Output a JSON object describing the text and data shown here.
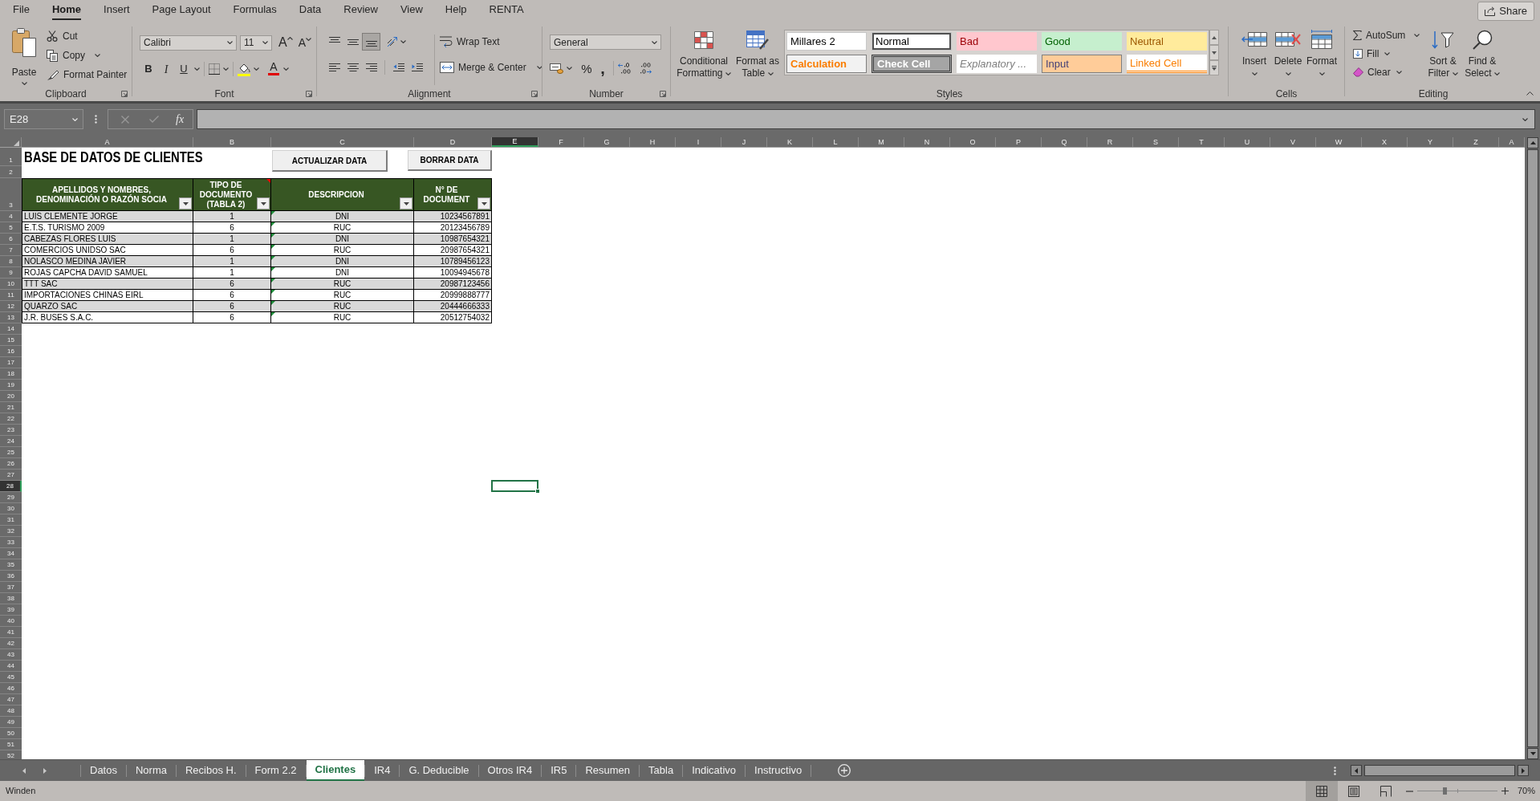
{
  "ribbon_tabs": [
    {
      "label": "File",
      "selected": false
    },
    {
      "label": "Home",
      "selected": true
    },
    {
      "label": "Insert",
      "selected": false
    },
    {
      "label": "Page Layout",
      "selected": false
    },
    {
      "label": "Formulas",
      "selected": false
    },
    {
      "label": "Data",
      "selected": false
    },
    {
      "label": "Review",
      "selected": false
    },
    {
      "label": "View",
      "selected": false
    },
    {
      "label": "Help",
      "selected": false
    },
    {
      "label": "RENTA",
      "selected": false
    }
  ],
  "share_button": {
    "label": "Share"
  },
  "ribbon": {
    "clipboard": {
      "paste": "Paste",
      "cut": "Cut",
      "copy": "Copy",
      "format_painter": "Format Painter",
      "label": "Clipboard"
    },
    "font": {
      "font_name": "Calibri",
      "font_size": "11",
      "grow_font": "A",
      "shrink_font": "A",
      "bold": "B",
      "italic": "I",
      "underline": "U",
      "font_color": "A",
      "label": "Font"
    },
    "alignment": {
      "vertical_align": [
        {
          "kind": "top",
          "selected": false
        },
        {
          "kind": "middle",
          "selected": false
        },
        {
          "kind": "bottom",
          "selected": true
        }
      ],
      "wrap_text": "Wrap Text",
      "merge_center": "Merge & Center",
      "label": "Alignment"
    },
    "number": {
      "format": "General",
      "percent": "%",
      "comma": ",",
      "label": "Number"
    },
    "styles": {
      "conditional_formatting": "Conditional Formatting",
      "format_as_table": "Format as Table",
      "gallery": [
        {
          "label": "Millares 2",
          "kind": "custom",
          "selected": false
        },
        {
          "label": "Normal",
          "kind": "normal",
          "selected": true
        },
        {
          "label": "Bad",
          "kind": "bad",
          "selected": false
        },
        {
          "label": "Good",
          "kind": "good",
          "selected": false
        },
        {
          "label": "Neutral",
          "kind": "neutral",
          "selected": false
        },
        {
          "label": "Calculation",
          "kind": "calculation",
          "selected": false
        },
        {
          "label": "Check Cell",
          "kind": "check",
          "selected": false
        },
        {
          "label": "Explanatory ...",
          "kind": "explanatory",
          "selected": false
        },
        {
          "label": "Input",
          "kind": "input",
          "selected": false
        },
        {
          "label": "Linked Cell",
          "kind": "linked",
          "selected": false
        }
      ],
      "label": "Styles"
    },
    "cells": {
      "buttons": [
        {
          "label": "Insert",
          "kind": "insert"
        },
        {
          "label": "Delete",
          "kind": "delete"
        },
        {
          "label": "Format",
          "kind": "format"
        }
      ],
      "label": "Cells"
    },
    "editing": {
      "autosum": "AutoSum",
      "fill": "Fill",
      "clear": "Clear",
      "sort_filter": "Sort & Filter",
      "find_select": "Find & Select",
      "label": "Editing"
    }
  },
  "formula_bar": {
    "name_box": "E28",
    "function_button": "fx"
  },
  "sheet": {
    "columns": [
      {
        "label": "A",
        "selected": false
      },
      {
        "label": "B",
        "selected": false
      },
      {
        "label": "C",
        "selected": false
      },
      {
        "label": "D",
        "selected": false
      },
      {
        "label": "E",
        "selected": true
      },
      {
        "label": "F",
        "selected": false
      },
      {
        "label": "G",
        "selected": false
      },
      {
        "label": "H",
        "selected": false
      },
      {
        "label": "I",
        "selected": false
      },
      {
        "label": "J",
        "selected": false
      },
      {
        "label": "K",
        "selected": false
      },
      {
        "label": "L",
        "selected": false
      },
      {
        "label": "M",
        "selected": false
      },
      {
        "label": "N",
        "selected": false
      },
      {
        "label": "O",
        "selected": false
      },
      {
        "label": "P",
        "selected": false
      },
      {
        "label": "Q",
        "selected": false
      },
      {
        "label": "R",
        "selected": false
      },
      {
        "label": "S",
        "selected": false
      },
      {
        "label": "T",
        "selected": false
      },
      {
        "label": "U",
        "selected": false
      },
      {
        "label": "V",
        "selected": false
      },
      {
        "label": "W",
        "selected": false
      },
      {
        "label": "X",
        "selected": false
      },
      {
        "label": "Y",
        "selected": false
      },
      {
        "label": "Z",
        "selected": false
      },
      {
        "label": "A",
        "selected": false
      }
    ],
    "rows": [
      {
        "label": "1",
        "selected": false
      },
      {
        "label": "2",
        "selected": false
      },
      {
        "label": "3",
        "selected": false
      },
      {
        "label": "4",
        "selected": false
      },
      {
        "label": "5",
        "selected": false
      },
      {
        "label": "6",
        "selected": false
      },
      {
        "label": "7",
        "selected": false
      },
      {
        "label": "8",
        "selected": false
      },
      {
        "label": "9",
        "selected": false
      },
      {
        "label": "10",
        "selected": false
      },
      {
        "label": "11",
        "selected": false
      },
      {
        "label": "12",
        "selected": false
      },
      {
        "label": "13",
        "selected": false
      },
      {
        "label": "14",
        "selected": false
      },
      {
        "label": "15",
        "selected": false
      },
      {
        "label": "16",
        "selected": false
      },
      {
        "label": "17",
        "selected": false
      },
      {
        "label": "18",
        "selected": false
      },
      {
        "label": "19",
        "selected": false
      },
      {
        "label": "20",
        "selected": false
      },
      {
        "label": "21",
        "selected": false
      },
      {
        "label": "22",
        "selected": false
      },
      {
        "label": "23",
        "selected": false
      },
      {
        "label": "24",
        "selected": false
      },
      {
        "label": "25",
        "selected": false
      },
      {
        "label": "26",
        "selected": false
      },
      {
        "label": "27",
        "selected": false
      },
      {
        "label": "28",
        "selected": true
      },
      {
        "label": "29",
        "selected": false
      },
      {
        "label": "30",
        "selected": false
      },
      {
        "label": "31",
        "selected": false
      },
      {
        "label": "32",
        "selected": false
      },
      {
        "label": "33",
        "selected": false
      },
      {
        "label": "34",
        "selected": false
      },
      {
        "label": "35",
        "selected": false
      },
      {
        "label": "36",
        "selected": false
      },
      {
        "label": "37",
        "selected": false
      },
      {
        "label": "38",
        "selected": false
      },
      {
        "label": "39",
        "selected": false
      },
      {
        "label": "40",
        "selected": false
      },
      {
        "label": "41",
        "selected": false
      },
      {
        "label": "42",
        "selected": false
      },
      {
        "label": "43",
        "selected": false
      },
      {
        "label": "44",
        "selected": false
      },
      {
        "label": "45",
        "selected": false
      },
      {
        "label": "46",
        "selected": false
      },
      {
        "label": "47",
        "selected": false
      },
      {
        "label": "48",
        "selected": false
      },
      {
        "label": "49",
        "selected": false
      },
      {
        "label": "50",
        "selected": false
      },
      {
        "label": "51",
        "selected": false
      },
      {
        "label": "52",
        "selected": false
      }
    ],
    "title": "BASE DE DATOS DE CLIENTES",
    "buttons": [
      {
        "label": "ACTUALIZAR DATA"
      },
      {
        "label": "BORRAR DATA"
      }
    ],
    "table": {
      "columns": [
        {
          "label": "APELLIDOS Y NOMBRES,\nDENOMINACIÓN O RAZÓN SOCIA",
          "comment": false
        },
        {
          "label": "TIPO DE\nDOCUMENTO\n(TABLA 2)",
          "comment": true
        },
        {
          "label": "DESCRIPCION",
          "comment": false
        },
        {
          "label": "N° DE\nDOCUMENT",
          "comment": false
        }
      ],
      "rows": [
        {
          "cells": [
            "LUIS CLEMENTE JORGE",
            "1",
            "DNI",
            "10234567891"
          ],
          "flagged": true
        },
        {
          "cells": [
            "E.T.S. TURISMO 2009",
            "6",
            "RUC",
            "20123456789"
          ],
          "flagged": true
        },
        {
          "cells": [
            "CABEZAS FLORES LUIS",
            "1",
            "DNI",
            "10987654321"
          ],
          "flagged": true
        },
        {
          "cells": [
            "COMERCIOS UNIDSO SAC",
            "6",
            "RUC",
            "20987654321"
          ],
          "flagged": true
        },
        {
          "cells": [
            "NOLASCO MEDINA JAVIER",
            "1",
            "DNI",
            "10789456123"
          ],
          "flagged": true
        },
        {
          "cells": [
            "ROJAS CAPCHA DAVID SAMUEL",
            "1",
            "DNI",
            "10094945678"
          ],
          "flagged": true
        },
        {
          "cells": [
            "TTT SAC",
            "6",
            "RUC",
            "20987123456"
          ],
          "flagged": true
        },
        {
          "cells": [
            "IMPORTACIONES CHINAS EIRL",
            "6",
            "RUC",
            "20999888777"
          ],
          "flagged": true
        },
        {
          "cells": [
            "QUARZO SAC",
            "6",
            "RUC",
            "20444666333"
          ],
          "flagged": true
        },
        {
          "cells": [
            "J.R. BUSES S.A.C.",
            "6",
            "RUC",
            "20512754032"
          ],
          "flagged": true
        }
      ]
    }
  },
  "sheet_tabs": [
    {
      "label": "Datos",
      "selected": false
    },
    {
      "label": "Norma",
      "selected": false
    },
    {
      "label": "Recibos H.",
      "selected": false
    },
    {
      "label": "Form 2.2",
      "selected": false
    },
    {
      "label": "Clientes",
      "selected": true
    },
    {
      "label": "IR4",
      "selected": false
    },
    {
      "label": "G. Deducible",
      "selected": false
    },
    {
      "label": "Otros IR4",
      "selected": false
    },
    {
      "label": "IR5",
      "selected": false
    },
    {
      "label": "Resumen",
      "selected": false
    },
    {
      "label": "Tabla",
      "selected": false
    },
    {
      "label": "Indicativo",
      "selected": false
    },
    {
      "label": "Instructivo",
      "selected": false
    }
  ],
  "status_bar": {
    "mode": "Winden",
    "views": [
      {
        "kind": "normal",
        "selected": true
      },
      {
        "kind": "page_layout",
        "selected": false
      },
      {
        "kind": "page_break",
        "selected": false
      }
    ],
    "zoom_slider": {
      "level": 0.34
    },
    "zoom": "70%"
  }
}
